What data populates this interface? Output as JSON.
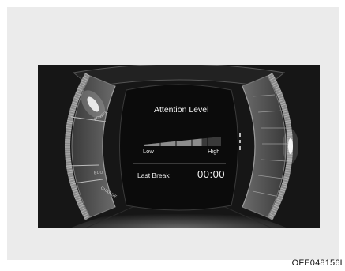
{
  "display": {
    "title": "Attention Level",
    "scale_low": "Low",
    "scale_high": "High",
    "last_break_label": "Last Break",
    "last_break_time": "00:00",
    "attention_level": 0.75
  },
  "gauge": {
    "modes": [
      "POWER",
      "ECO",
      "CHARGE"
    ]
  },
  "figure_code": "OFE048156L"
}
